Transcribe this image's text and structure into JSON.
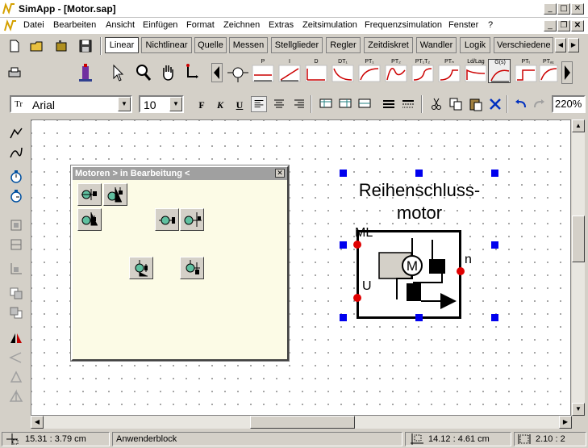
{
  "app": {
    "title": "SimApp - [Motor.sap]"
  },
  "menu": [
    "Datei",
    "Bearbeiten",
    "Ansicht",
    "Einfügen",
    "Format",
    "Zeichnen",
    "Extras",
    "Zeitsimulation",
    "Frequenzsimulation",
    "Fenster",
    "?"
  ],
  "tabs": [
    {
      "label": "Linear",
      "active": true
    },
    {
      "label": "Nichtlinear"
    },
    {
      "label": "Quelle"
    },
    {
      "label": "Messen"
    },
    {
      "label": "Stellglieder"
    },
    {
      "label": "Regler"
    },
    {
      "label": "Zeitdiskret"
    },
    {
      "label": "Wandler"
    },
    {
      "label": "Logik"
    },
    {
      "label": "Verschiedene"
    }
  ],
  "blocks": [
    "P",
    "I",
    "D",
    "DT₁",
    "PT₁",
    "PT₂",
    "PT₁T₂",
    "PTₙ",
    "Ld/Lag",
    "G(s)",
    "PTₜ",
    "PTₐ₁"
  ],
  "format": {
    "font": "Arial",
    "size": "10",
    "zoom": "220%",
    "bold": "F",
    "italic": "K",
    "underline": "U"
  },
  "palette": {
    "title": "Motoren > in Bearbeitung <",
    "close": "✕"
  },
  "diagram": {
    "block_title_line1": "Reihenschluss-",
    "block_title_line2": "motor",
    "port_ml": "ML",
    "port_u": "U",
    "port_n": "n",
    "motor_symbol": "M"
  },
  "status": {
    "coords_left": "15.31 :   3.79 cm",
    "block_type": "Anwenderblock",
    "coords_right": "14.12 :   4.61 cm",
    "size": "2.10 :  2"
  },
  "colors": {
    "selection_handle": "#0000ee",
    "port": "#e00000",
    "palette_bg": "#fcfbe6"
  }
}
